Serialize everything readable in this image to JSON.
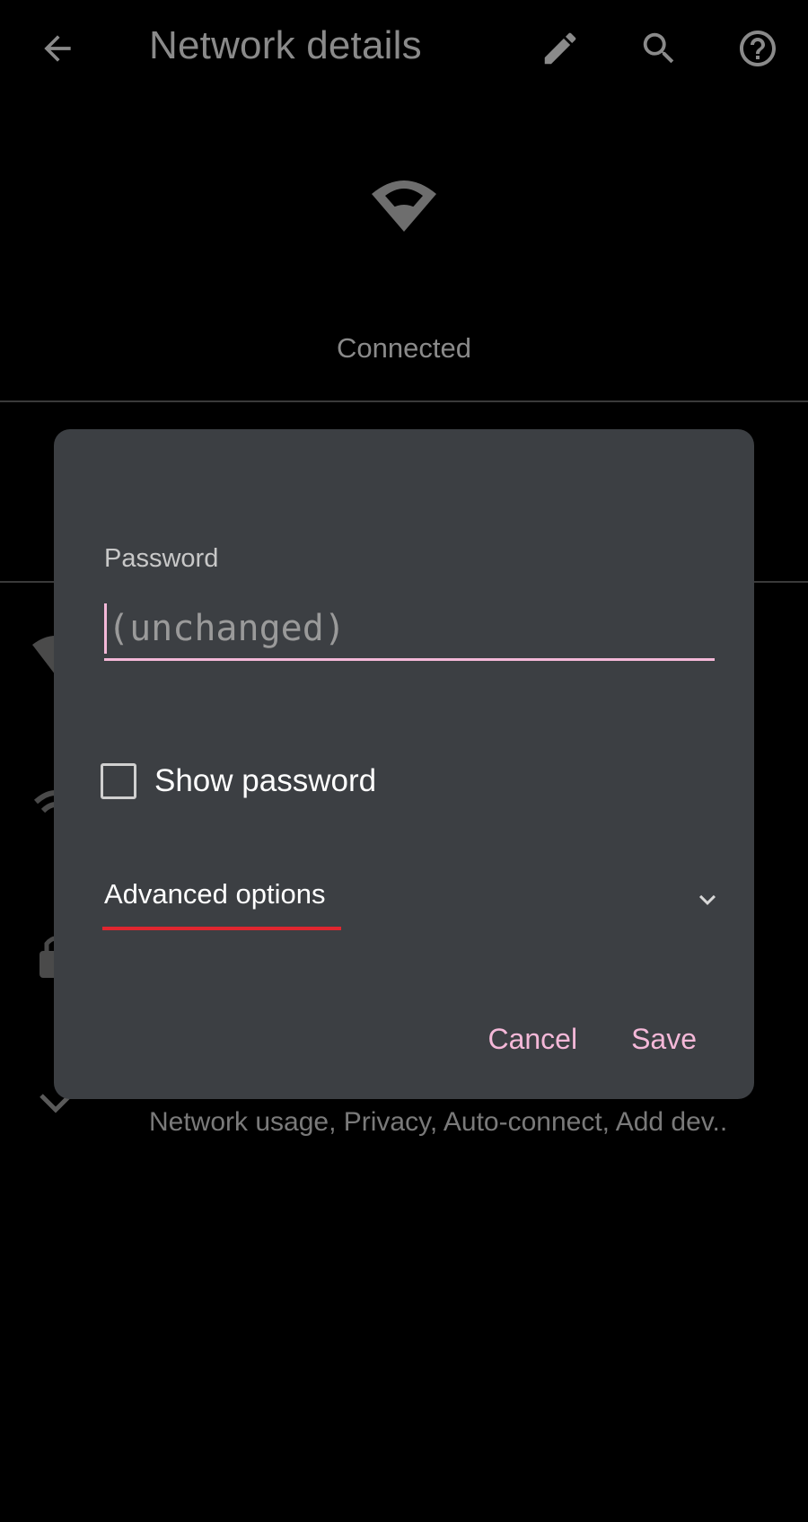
{
  "app_bar": {
    "title": "Network details",
    "back_icon": "arrow-back-icon",
    "edit_icon": "pencil-icon",
    "search_icon": "search-icon",
    "help_icon": "help-circle-icon"
  },
  "network": {
    "status": "Connected",
    "signal_icon": "wifi-icon"
  },
  "background_rows": {
    "advanced_subtitle": "Network usage, Privacy, Auto-connect, Add dev.."
  },
  "dialog": {
    "password_label": "Password",
    "password_placeholder": "(unchanged)",
    "show_password_label": "Show password",
    "show_password_checked": false,
    "advanced_options_label": "Advanced options",
    "cancel_label": "Cancel",
    "save_label": "Save"
  },
  "colors": {
    "accent": "#f4b8d8",
    "dialog_bg": "#3c3f43",
    "focus_underline": "#e0262f"
  }
}
